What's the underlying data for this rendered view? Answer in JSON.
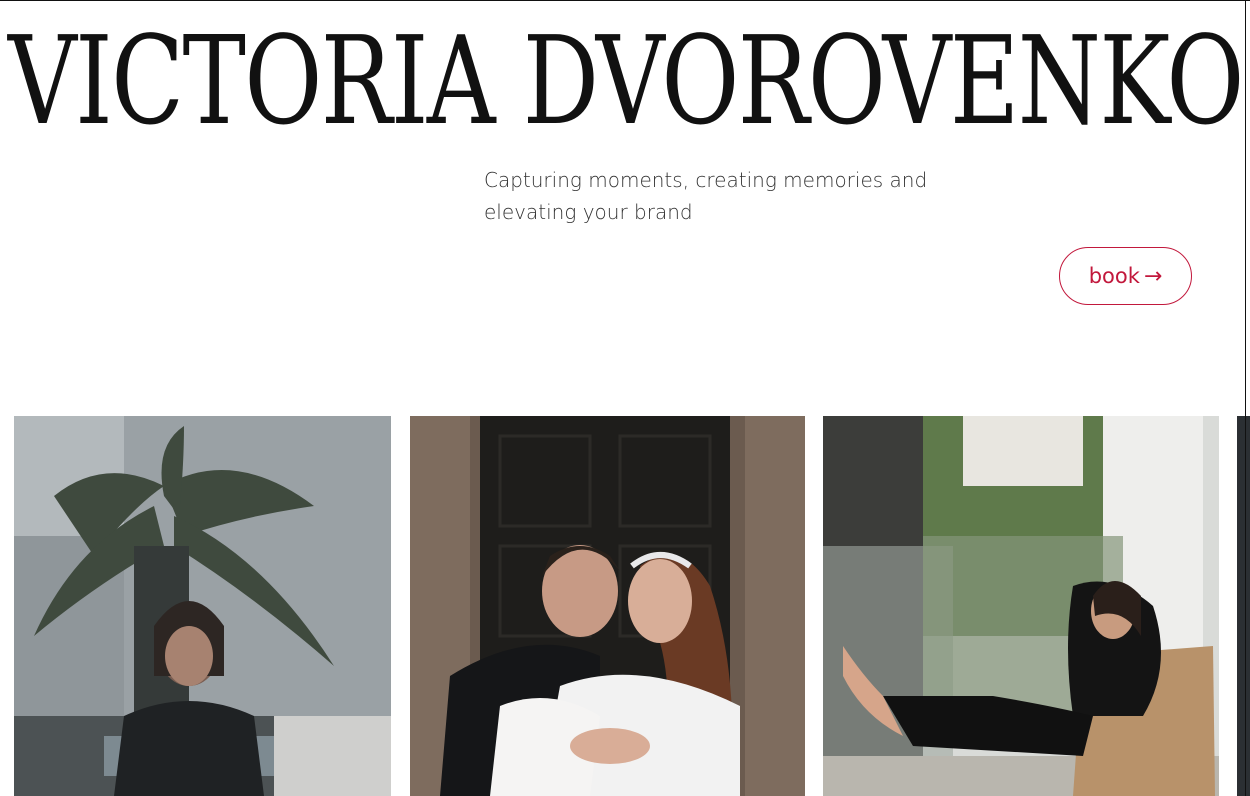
{
  "header": {
    "brand_name": "VICTORIA DVOROVENKO",
    "tagline": "Capturing moments, creating memories and elevating your brand",
    "book_label": "book",
    "book_arrow": "→"
  },
  "colors": {
    "accent": "#c2183c",
    "text": "#111111",
    "background": "#ffffff"
  },
  "gallery": {
    "photos": [
      {
        "subject": "woman-reflection-palm-tree-photo"
      },
      {
        "subject": "wedding-couple-photo"
      },
      {
        "subject": "woman-seated-balcony-chair-photo"
      },
      {
        "subject": "partial-next-photo"
      }
    ]
  }
}
